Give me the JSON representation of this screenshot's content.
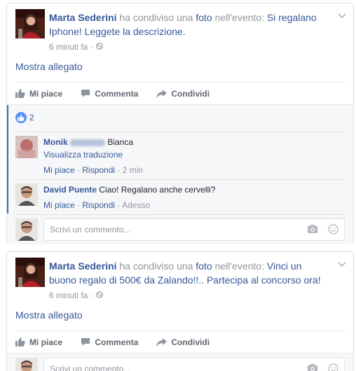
{
  "posts": [
    {
      "author": "Marta Sederini",
      "shared_text": "ha condiviso una",
      "photo_link": "foto",
      "event_text": "nell'evento:",
      "event_title": "Si regalano Iphone! Leggete la descrizione.",
      "time": "6 minuti fa",
      "dot": "·",
      "attachment_link": "Mostra allegato",
      "like_label": "Mi piace",
      "comment_label": "Commenta",
      "share_label": "Condividi",
      "like_count": "2",
      "comments": [
        {
          "author_first": "Monik",
          "author_last": "Bianca",
          "text": "",
          "translate": "Visualizza traduzione",
          "like": "Mi piace",
          "reply": "Rispondi",
          "time": "2 min"
        },
        {
          "author_first": "David Puente",
          "text": "Ciao! Regalano anche cervelli?",
          "like": "Mi piace",
          "reply": "Rispondi",
          "time": "Adesso"
        }
      ],
      "write_placeholder": "Scrivi un commento..."
    },
    {
      "author": "Marta Sederini",
      "shared_text": "ha condiviso una",
      "photo_link": "foto",
      "event_text": "nell'evento:",
      "event_title": "Vinci un buono regalo di 500€ da Zalando!!.. Partecipa al concorso ora!",
      "time": "6 minuti fa",
      "dot": "·",
      "attachment_link": "Mostra allegato",
      "like_label": "Mi piace",
      "comment_label": "Commenta",
      "share_label": "Condividi",
      "write_placeholder": "Scrivi un commento..."
    }
  ],
  "separators": {
    "dot": "·"
  },
  "colors": {
    "link": "#365899",
    "meta": "#90949c",
    "like_blue": "#5890ff",
    "bar": "#4267b2"
  }
}
